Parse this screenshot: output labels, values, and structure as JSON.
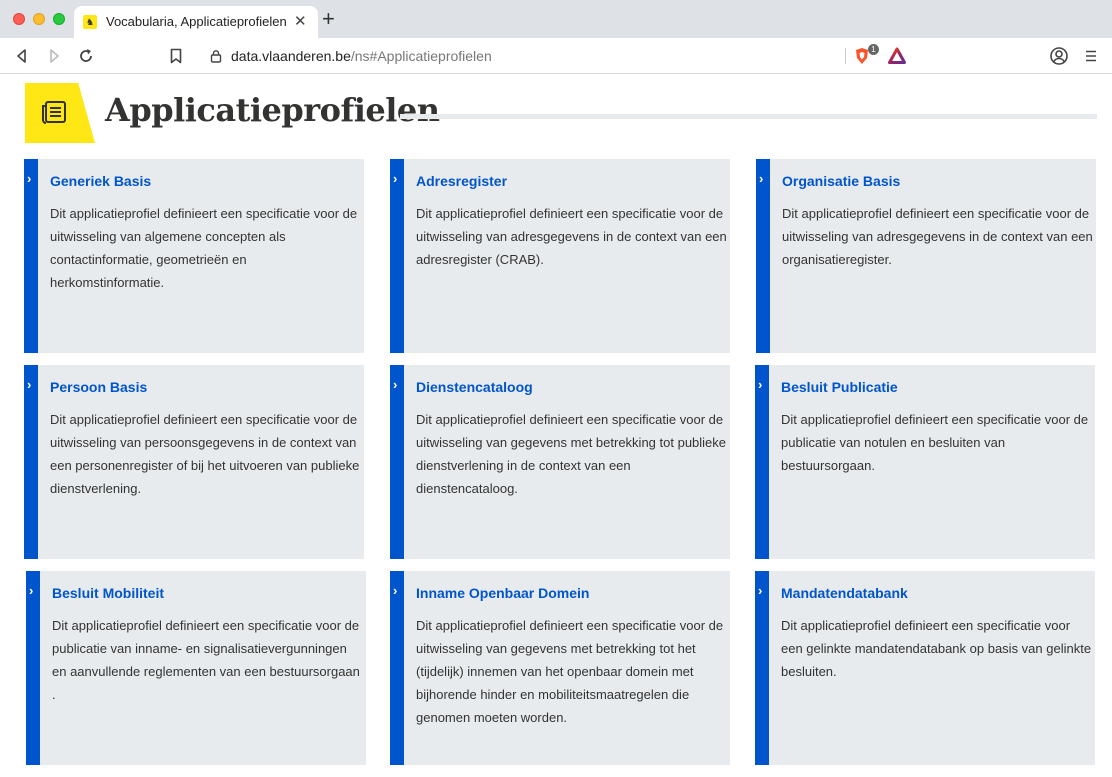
{
  "browser": {
    "tab_title": "Vocabularia, Applicatieprofielen",
    "tab_close": "✕",
    "new_tab": "+",
    "url_host": "data.vlaanderen.be",
    "url_path": "/ns#Applicatieprofielen",
    "shield_count": "1",
    "icons": [
      "back-icon",
      "forward-icon",
      "reload-icon",
      "bookmark-icon",
      "lock-icon",
      "brave-shield-icon",
      "brave-rewards-icon",
      "profile-icon",
      "menu-icon"
    ]
  },
  "page": {
    "title": "Applicatieprofielen",
    "accent_color": "#ffe615",
    "link_color": "#0055cc",
    "cards": [
      {
        "title": "Generiek Basis",
        "description": "Dit applicatieprofiel definieert een specificatie voor de uitwisseling van algemene concepten als contactinformatie, geometrieën en herkomstinformatie."
      },
      {
        "title": "Adresregister",
        "description": "Dit applicatieprofiel definieert een specificatie voor de uitwisseling van adresgegevens in de context van een adresregister (CRAB)."
      },
      {
        "title": "Organisatie Basis",
        "description": "Dit applicatieprofiel definieert een specificatie voor de uitwisseling van adresgegevens in de context van een organisatieregister."
      },
      {
        "title": "Persoon Basis",
        "description": "Dit applicatieprofiel definieert een specificatie voor de uitwisseling van persoonsgegevens in de context van een personenregister of bij het uitvoeren van publieke dienstverlening."
      },
      {
        "title": "Dienstencataloog",
        "description": "Dit applicatieprofiel definieert een specificatie voor de uitwisseling van gegevens met betrekking tot publieke dienstverlening in de context van een dienstencataloog."
      },
      {
        "title": "Besluit Publicatie",
        "description": "Dit applicatieprofiel definieert een specificatie voor de publicatie van notulen en besluiten van bestuursorgaan."
      },
      {
        "title": "Besluit Mobiliteit",
        "description": "Dit applicatieprofiel definieert een specificatie voor de publicatie van inname- en signalisatievergunningen en aanvullende reglementen van een bestuursorgaan ."
      },
      {
        "title": "Inname Openbaar Domein",
        "description": "Dit applicatieprofiel definieert een specificatie voor de uitwisseling van gegevens met betrekking tot het (tijdelijk) innemen van het openbaar domein met bijhorende hinder en mobiliteitsmaatregelen die genomen moeten worden."
      },
      {
        "title": "Mandatendatabank",
        "description": "Dit applicatieprofiel definieert een specificatie voor een gelinkte mandatendatabank op basis van gelinkte besluiten."
      }
    ]
  }
}
